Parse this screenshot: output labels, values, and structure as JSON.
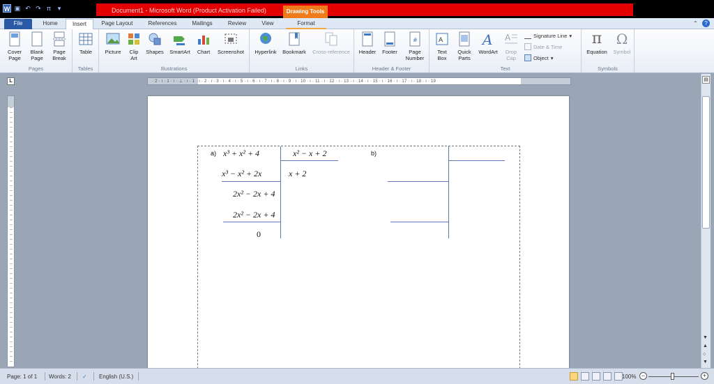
{
  "titlebar": {
    "title": "Document1  -  Microsoft Word (Product Activation Failed)",
    "contextual_tab": "Drawing Tools",
    "accent_color": "#e20000"
  },
  "qat": {
    "app_icon": "W"
  },
  "tabs": [
    "File",
    "Home",
    "Insert",
    "Page Layout",
    "References",
    "Mailings",
    "Review",
    "View",
    "Format"
  ],
  "active_tab": "Insert",
  "ribbon": {
    "pages": {
      "label": "Pages",
      "cover": "Cover",
      "cover2": "Page",
      "blank": "Blank",
      "blank2": "Page",
      "break": "Page",
      "break2": "Break"
    },
    "tables": {
      "label": "Tables",
      "table": "Table"
    },
    "illustrations": {
      "label": "Illustrations",
      "picture": "Picture",
      "clip": "Clip",
      "clip2": "Art",
      "shapes": "Shapes",
      "smartart": "SmartArt",
      "chart": "Chart",
      "screenshot": "Screenshot"
    },
    "links": {
      "label": "Links",
      "hyperlink": "Hyperlink",
      "bookmark": "Bookmark",
      "crossref": "Cross-reference"
    },
    "header_footer": {
      "label": "Header & Footer",
      "header": "Header",
      "footer": "Footer",
      "page_number": "Page",
      "page_number2": "Number"
    },
    "text": {
      "label": "Text",
      "textbox": "Text",
      "textbox2": "Box",
      "quickparts": "Quick",
      "quickparts2": "Parts",
      "wordart": "WordArt",
      "dropcap": "Drop",
      "dropcap2": "Cap",
      "signature": "Signature Line",
      "datetime": "Date & Time",
      "object": "Object"
    },
    "symbols": {
      "label": "Symbols",
      "equation": "Equation",
      "symbol": "Symbol"
    }
  },
  "ruler": {
    "numbers": "· 2 · ı · 1 · ı · ⊥ · ı · 1 · ı · 2 · ı · 3 · ı · 4 · ı · 5 · ı · 6 · ı · 7 · ı · 8 · ı · 9 · ı · 10 · ı · 11 · ı · 12 · ı · 13 · ı · 14 · ı · 15 · ı · 16 · ı · 17 · ı · 18 · ı · 19"
  },
  "document": {
    "a_label": "a)",
    "b_label": "b)",
    "dividend": "x³ + x² + 4",
    "divisor": "x² − x + 2",
    "quotient": "x + 2",
    "step1": "x³ − x² + 2x",
    "step2": "2x² − 2x + 4",
    "step3": "2x² − 2x + 4",
    "remainder": "0"
  },
  "statusbar": {
    "page": "Page: 1 of 1",
    "words": "Words: 2",
    "language": "English (U.S.)",
    "zoom": "100%"
  }
}
